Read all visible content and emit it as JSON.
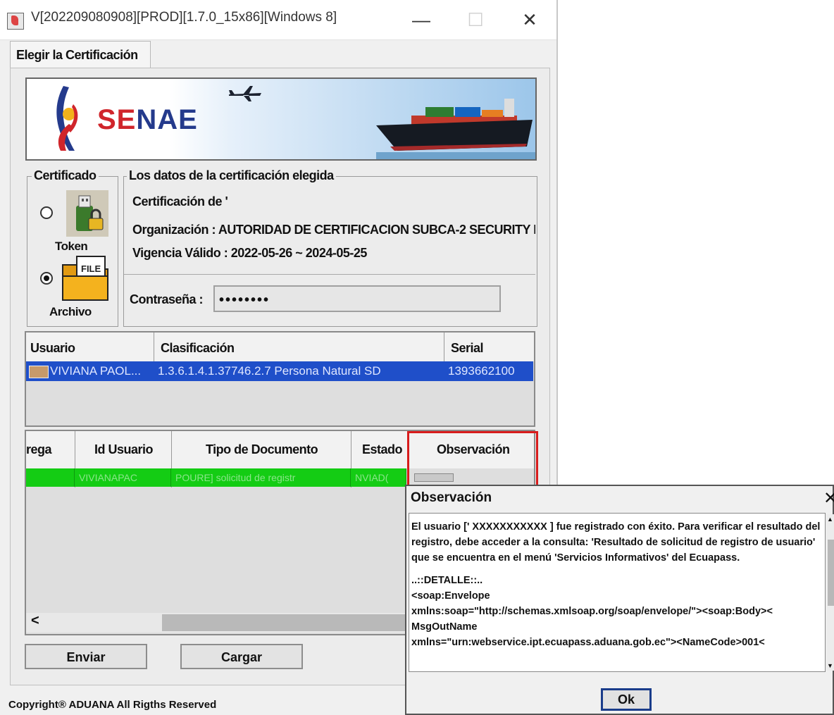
{
  "window": {
    "title": "V[202209080908][PROD][1.7.0_15x86][Windows 8]",
    "minimize": "—",
    "maximize": "☐",
    "close": "✕"
  },
  "tab": {
    "label": "Elegir la Certificación"
  },
  "banner": {
    "brand_se": "SE",
    "brand_nae": "NAE"
  },
  "certificado": {
    "legend": "Certificado",
    "token_label": "Token",
    "archivo_label": "Archivo",
    "file_badge": "FILE",
    "selected": "Archivo"
  },
  "datos": {
    "legend": "Los datos de la certificación elegida",
    "cert_de": "Certificación de '",
    "organizacion": "Organización : AUTORIDAD DE CERTIFICACION SUBCA-2 SECURITY I",
    "vigencia": "Vigencia Válido : 2022-05-26 ~ 2024-05-25",
    "password_label": "Contraseña :",
    "password_value": "••••••••"
  },
  "cert_table": {
    "headers": [
      "Usuario",
      "Clasificación",
      "Serial"
    ],
    "rows": [
      {
        "usuario": "VIVIANA PAOL...",
        "clasificacion": "1.3.6.1.4.1.37746.2.7 Persona Natural SD",
        "serial": "1393662100"
      }
    ]
  },
  "doc_table": {
    "headers": [
      "rega",
      "Id Usuario",
      "Tipo de Documento",
      "Estado",
      "Observación"
    ],
    "rows": [
      {
        "entrega": "",
        "id_usuario": "VIVIANAPAC",
        "tipo": "POURE] solicitud de registr",
        "estado": "NVIAD(",
        "observacion": ""
      }
    ],
    "scroll_left": "<"
  },
  "buttons": {
    "enviar": "Enviar",
    "cargar": "Cargar"
  },
  "copyright": "Copyright® ADUANA All Rigths Reserved",
  "dialog": {
    "title": "Observación",
    "close": "✕",
    "message": "El usuario [' XXXXXXXXXXX ] fue registrado con éxito. Para verificar el resultado del registro, debe acceder a la consulta: 'Resultado de solicitud de registro de usuario' que se encuentra en el menú 'Servicios Informativos' del Ecuapass.",
    "detalle": "  ..::DETALLE::..",
    "soap1": "<soap:Envelope",
    "soap2": "xmlns:soap=\"http://schemas.xmlsoap.org/soap/envelope/\"><soap:Body><",
    "soap3": "MsgOutName",
    "soap4": "xmlns=\"urn:webservice.ipt.ecuapass.aduana.gob.ec\"><NameCode>001<",
    "ok": "Ok",
    "scroll_up": "▲",
    "scroll_down": "▼"
  },
  "colors": {
    "selection_blue": "#1f4fc9",
    "status_green": "#14cc14",
    "highlight_red": "#d81c1c",
    "brand_red": "#d0252b",
    "brand_blue": "#243a8c"
  }
}
